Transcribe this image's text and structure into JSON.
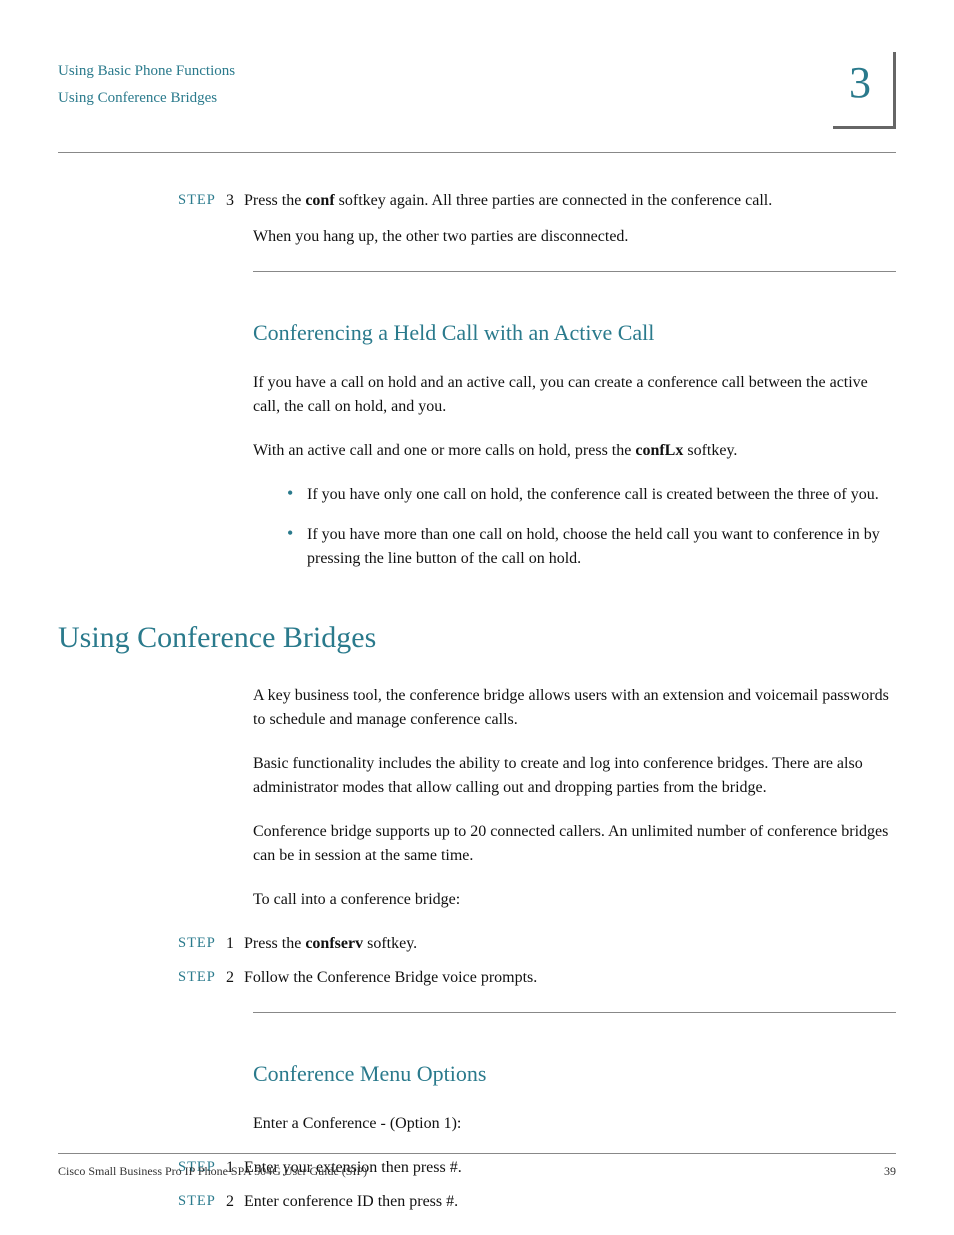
{
  "header": {
    "crumb1": "Using Basic Phone Functions",
    "crumb2": "Using Conference Bridges",
    "chapter": "3"
  },
  "labels": {
    "step": "STEP"
  },
  "step3": {
    "num": "3",
    "text_a": "Press the ",
    "bold": "conf",
    "text_b": " softkey again. All three parties are connected in the conference call.",
    "para2": "When you hang up, the other two parties are disconnected."
  },
  "sec1": {
    "title": "Conferencing a Held Call with an Active Call",
    "p1": "If you have a call on hold and an active call, you can create a conference call between the active call, the call on hold, and you.",
    "p2a": "With an active call and one or more calls on hold, press the ",
    "p2bold": "confLx",
    "p2b": " softkey.",
    "b1": "If you have only one call on hold, the conference call is created between the three of you.",
    "b2": "If you have more than one call on hold, choose the held call you want to conference in by pressing the line button of the call on hold."
  },
  "sec2": {
    "title": "Using Conference Bridges",
    "p1": "A key business tool, the conference bridge allows users with an extension and voicemail passwords to schedule and manage conference calls.",
    "p2": "Basic functionality includes the ability to create and log into conference bridges. There are also administrator modes that allow calling out and dropping parties from the bridge.",
    "p3": "Conference bridge supports up to 20 connected callers. An unlimited number of conference bridges can be in session at the same time.",
    "p4": "To call into a conference bridge:",
    "s1num": "1",
    "s1a": "Press the ",
    "s1bold": "confserv",
    "s1b": " softkey.",
    "s2num": "2",
    "s2": "Follow the Conference Bridge voice prompts."
  },
  "sec3": {
    "title": "Conference Menu Options",
    "p1": "Enter a Conference - (Option 1):",
    "s1num": "1",
    "s1": "Enter your extension then press #.",
    "s2num": "2",
    "s2": "Enter conference ID then press #."
  },
  "footer": {
    "left": "Cisco Small Business Pro IP Phone SPA 504G User Guide (SIP)",
    "right": "39"
  }
}
